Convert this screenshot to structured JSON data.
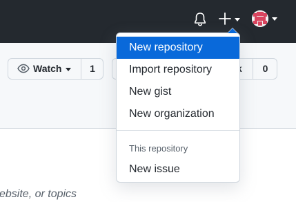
{
  "header": {
    "icons": [
      "bell-icon",
      "plus-icon",
      "chevron-down-icon",
      "avatar"
    ]
  },
  "repo": {
    "watch_label": "Watch",
    "watch_count": "1",
    "fork_edge_text": "k",
    "fork_count": "0"
  },
  "description_hint": "ebsite, or topics",
  "menu": {
    "items": [
      {
        "label": "New repository",
        "active": true
      },
      {
        "label": "Import repository"
      },
      {
        "label": "New gist"
      },
      {
        "label": "New organization"
      }
    ],
    "section_header": "This repository",
    "section_items": [
      {
        "label": "New issue"
      }
    ]
  },
  "colors": {
    "header_bg": "#24292f",
    "accent": "#0969da",
    "avatar_color": "#d9455f"
  }
}
